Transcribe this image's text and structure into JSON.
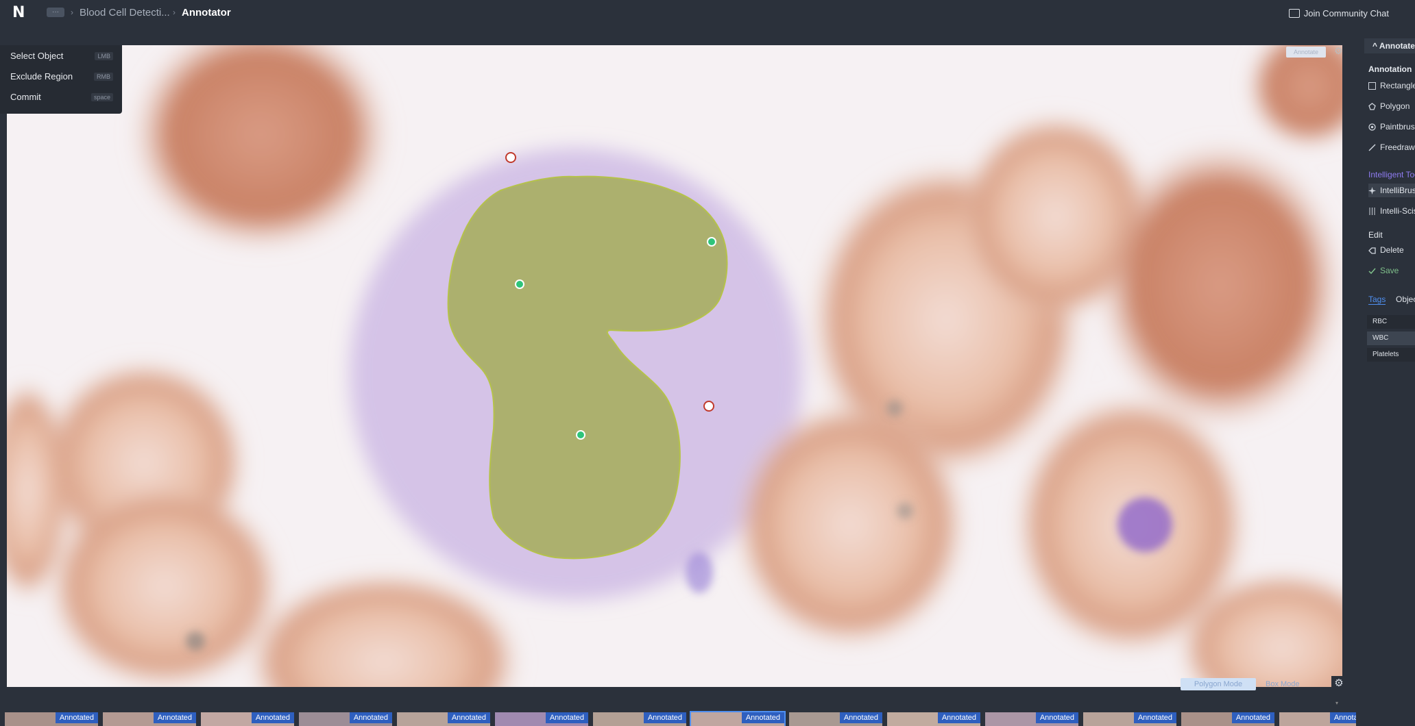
{
  "topbar": {
    "logo": "N",
    "breadcrumb_more": "···",
    "separator": "›",
    "project": "Blood Cell Detecti...",
    "current": "Annotator",
    "community_button": "Join Community Chat"
  },
  "shortcuts": [
    {
      "label": "Select Object",
      "key": "LMB"
    },
    {
      "label": "Exclude Region",
      "key": "RMB"
    },
    {
      "label": "Commit",
      "key": "space"
    }
  ],
  "canvas": {
    "tag": "Annotate",
    "mode_polygon": "Polygon Mode",
    "mode_box": "Box Mode",
    "mask_color": "#9aa83a",
    "include_point_color": "#2fc47a",
    "exclude_point_color": "#c0392b"
  },
  "right_panel": {
    "header": "Annotate",
    "annotation_section": "Annotation",
    "tools": [
      {
        "label": "Rectangle",
        "icon": "rectangle-icon"
      },
      {
        "label": "Polygon",
        "icon": "polygon-icon"
      },
      {
        "label": "Paintbrush",
        "icon": "paintbrush-icon"
      },
      {
        "label": "Freedraw",
        "icon": "freedraw-icon"
      }
    ],
    "intelligent_section": "Intelligent Tools",
    "intelligent_tools": [
      {
        "label": "IntelliBrush",
        "icon": "sparkle-icon"
      },
      {
        "label": "Intelli-Scissors",
        "icon": "sliders-icon"
      }
    ],
    "edit_section": "Edit",
    "edit_tools": [
      {
        "label": "Delete",
        "icon": "delete-icon"
      },
      {
        "label": "Save",
        "icon": "check-icon"
      }
    ],
    "tabs": {
      "tags": "Tags",
      "objects": "Objects"
    },
    "tags": [
      "RBC",
      "WBC",
      "Platelets"
    ]
  },
  "filmstrip": {
    "badge": "Annotated",
    "count": 14,
    "selected_index": 7
  }
}
